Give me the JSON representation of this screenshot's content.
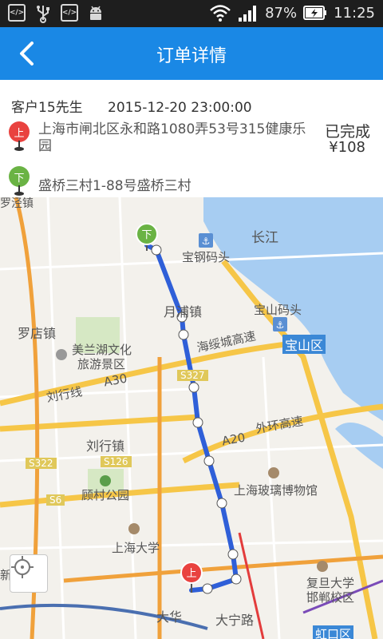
{
  "status_bar": {
    "battery": "87%",
    "time": "11:25",
    "icons": [
      "code-icon",
      "usb-icon",
      "code-icon",
      "android-icon",
      "wifi-icon",
      "signal-icon",
      "battery-icon"
    ]
  },
  "navbar": {
    "title": "订单详情",
    "back_icon": "chevron-left-icon"
  },
  "order": {
    "customer": "客户15先生",
    "datetime": "2015-12-20 23:00:00",
    "pickup_badge": "上",
    "pickup_address": "上海市闸北区永和路1080弄53号315健康乐园",
    "dropoff_badge": "下",
    "dropoff_address": "盛桥三村1-88号盛桥三村",
    "status": "已完成",
    "price": "¥108"
  },
  "map": {
    "labels": {
      "changjiang": "长江",
      "baogang": "宝钢码头",
      "baoshan_dock": "宝山码头",
      "yuepu": "月浦镇",
      "luodian": "罗店镇",
      "meilanhu1": "美兰湖文化",
      "meilanhu2": "旅游景区",
      "haijia": "海绥城高速",
      "baoshan_district": "宝山区",
      "s327": "S327",
      "liuxing": "刘行线",
      "a30": "A30",
      "a20": "A20",
      "waihuan": "外环高速",
      "liuhang": "刘行镇",
      "s322": "S322",
      "s126": "S126",
      "gucun": "顾村公园",
      "s6": "S6",
      "glass": "上海玻璃博物馆",
      "shu": "上海大学",
      "fudan1": "复旦大学",
      "fudan2": "邯郸校区",
      "dahua": "大华",
      "daning": "大宁路",
      "hongkou": "虹口区",
      "top_left": "罗泾镇",
      "left_edge": "新"
    },
    "route": {
      "start_badge": "上",
      "end_badge": "下",
      "color": "#2f5fd8"
    },
    "locate_icon": "crosshair-icon"
  }
}
